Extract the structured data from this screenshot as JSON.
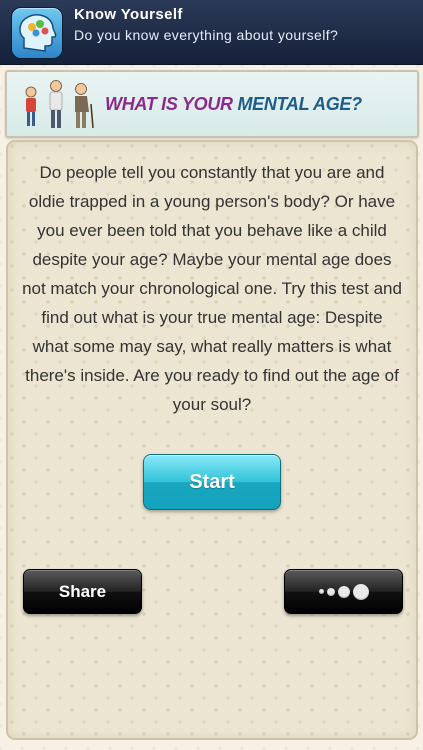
{
  "header": {
    "title": "Know Yourself",
    "subtitle": "Do you know everything about yourself?",
    "icon": "brain-head-icon"
  },
  "banner": {
    "title_part1": "What is your ",
    "title_part2": "mental age?",
    "illustration": "three-generations-figures"
  },
  "card": {
    "intro_text": "Do people tell you constantly that you are and oldie trapped in a young person's body? Or have you ever been told that you behave like a child despite your age? Maybe your mental age does not match your chronological one. Try this test and find out what is your true mental age: Despite what some may say, what really matters is what there's inside. Are you ready to find out the age of your soul?"
  },
  "buttons": {
    "start_label": "Start",
    "share_label": "Share",
    "more_icon": "more-dots-icon"
  },
  "colors": {
    "header_bg": "#1c2843",
    "start_accent": "#2fc3d9",
    "banner_purple": "#8a2a8c",
    "banner_blue": "#1f5c8a"
  }
}
